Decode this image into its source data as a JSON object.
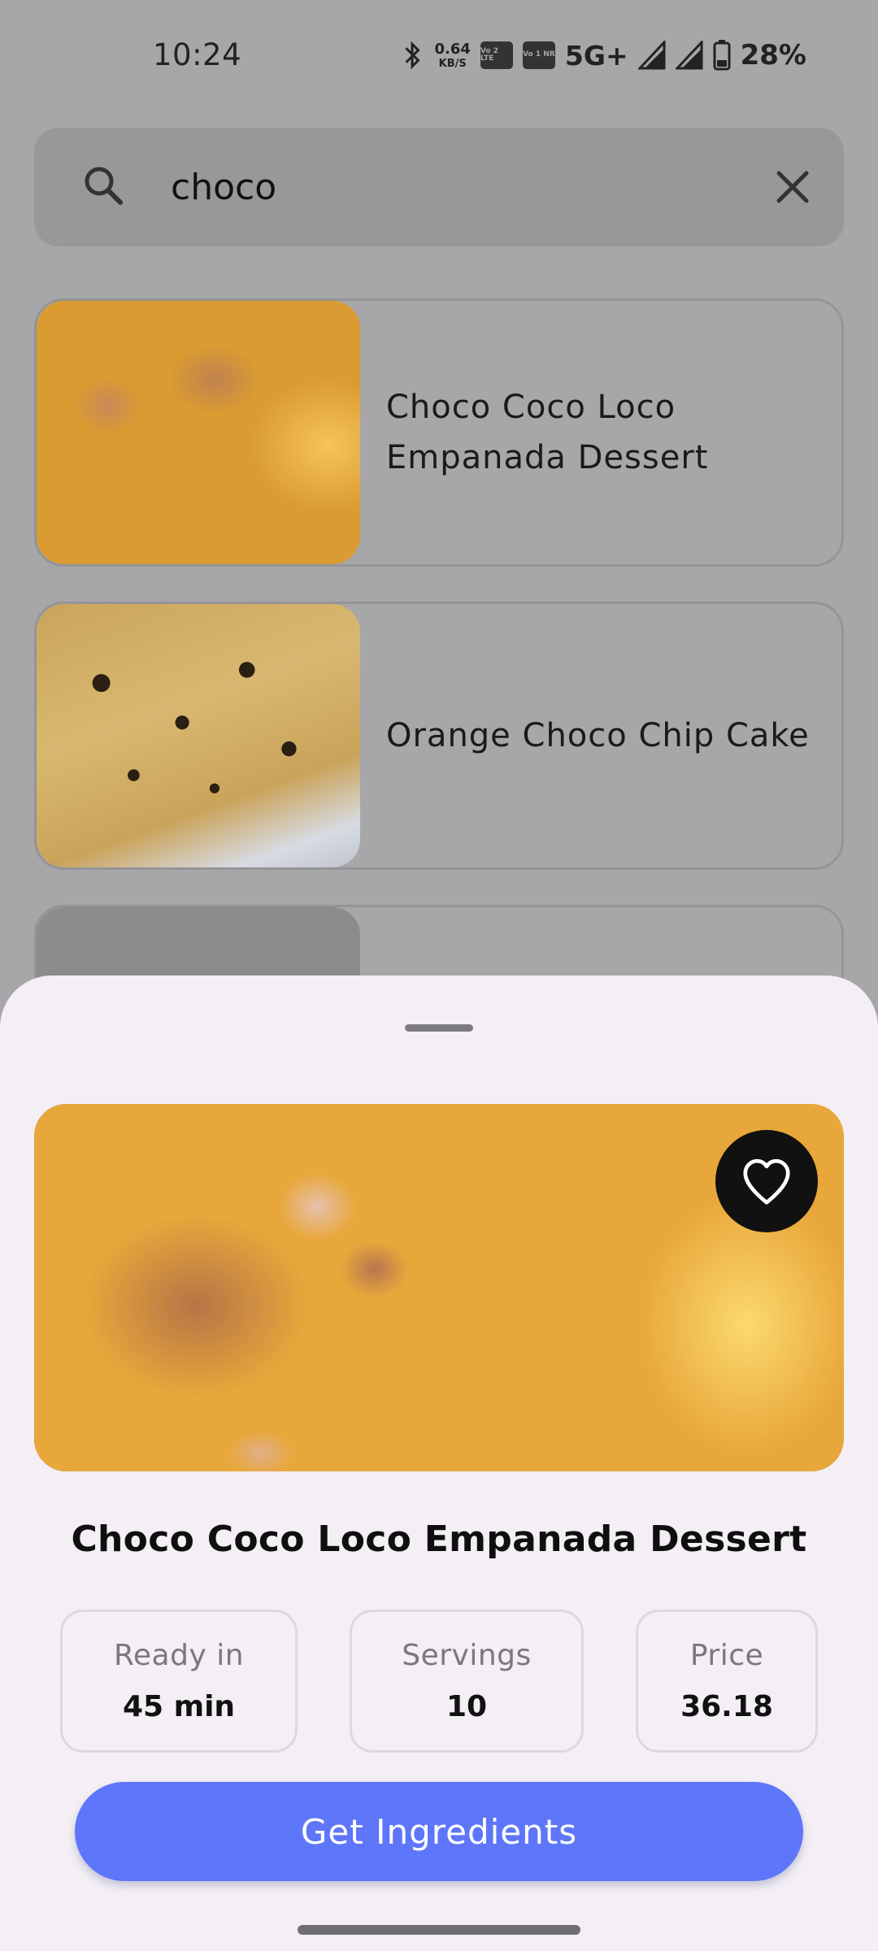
{
  "status_bar": {
    "time": "10:24",
    "speed_value": "0.64",
    "speed_unit": "KB/S",
    "sim1": "Vo 2 LTE",
    "sim2": "Vo 1 NR",
    "network": "5G+",
    "battery": "28%",
    "icons": [
      "bluetooth-icon",
      "volte-icon",
      "signal-icon",
      "battery-icon"
    ]
  },
  "search": {
    "query": "choco"
  },
  "results": [
    {
      "title": "Choco Coco Loco Empanada Dessert"
    },
    {
      "title": "Orange Choco Chip Cake"
    },
    {
      "title": ""
    }
  ],
  "detail": {
    "title": "Choco Coco Loco Empanada Dessert",
    "stats": [
      {
        "label": "Ready in",
        "value": "45 min"
      },
      {
        "label": "Servings",
        "value": "10"
      },
      {
        "label": "Price",
        "value": "36.18"
      }
    ],
    "cta_label": "Get Ingredients"
  },
  "colors": {
    "accent": "#5e76f9",
    "scrim": "#a7a6a9",
    "sheet": "#f3eff4",
    "favorite_bg": "#111111"
  }
}
